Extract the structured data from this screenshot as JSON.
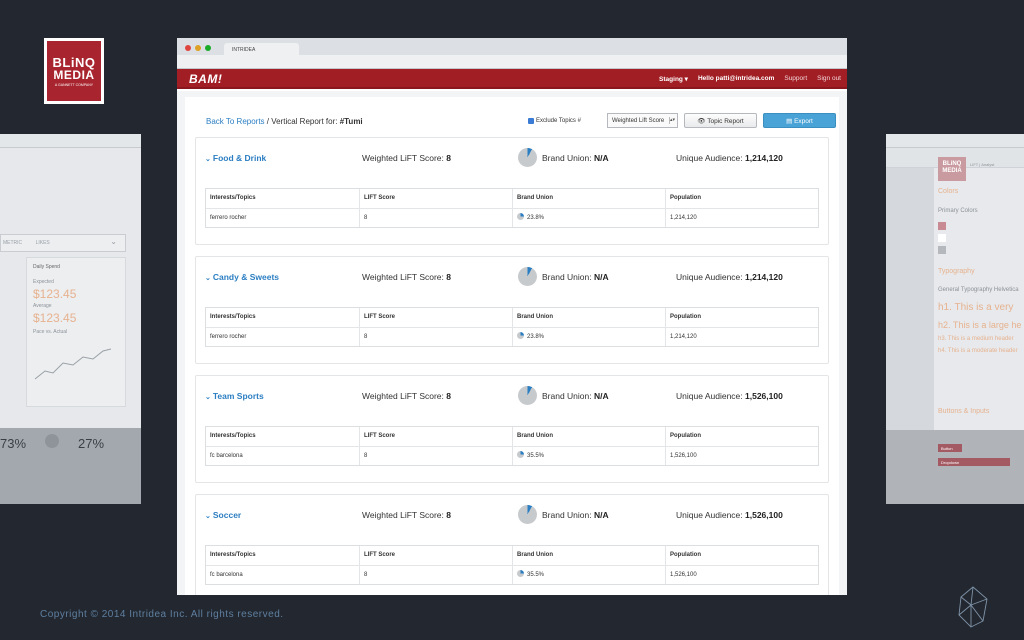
{
  "logo": {
    "line1": "BLiNQ",
    "line2": "MEDIA",
    "line3": "A GANNETT COMPANY"
  },
  "side_left": {
    "metric_label": "METRIC",
    "metric_value": "LIKES",
    "daily_spend_label": "Daily Spend",
    "expected_label": "Expected",
    "expected_value": "$123.45",
    "average_label": "Average",
    "average_value": "$123.45",
    "pace_label": "Pace vs. Actual",
    "pct_left": "73%",
    "pct_right": "27%"
  },
  "side_right": {
    "logo_l1": "BLiNQ",
    "logo_l2": "MEDIA",
    "header_text": "LIFT | Analyst",
    "colors_heading": "Colors",
    "primary_colors": "Primary Colors",
    "typography_heading": "Typography",
    "general_typography": "General Typography Helvetica",
    "h1": "h1. This is a very",
    "h2": "h2. This is a large he",
    "h3": "h3. This is a medium header",
    "h4": "h4. This is a moderate header",
    "buttons_heading": "Buttons & Inputs",
    "button_label": "Button",
    "dropdown_label": "Dropdown"
  },
  "browser": {
    "tab_title": "INTRIDEA",
    "dot_colors": [
      "#e0443e",
      "#dea123",
      "#1aab29"
    ]
  },
  "appbar": {
    "brand": "BAM!",
    "staging": "Staging ▾",
    "hello": "Hello patti@intridea.com",
    "support": "Support",
    "signout": "Sign out"
  },
  "toolbar": {
    "back_link": "Back To Reports",
    "crumb_rest": " / Vertical Report for: ",
    "crumb_tag": "#Tumi",
    "exclude_label": "Exclude Topics #",
    "select_value": "Weighted Lift Score",
    "topic_report": "👁 Topic Report",
    "export": "▤ Export"
  },
  "table_headers": [
    "Interests/Topics",
    "LIFT Score",
    "Brand Union",
    "Population"
  ],
  "sections": [
    {
      "title": "Food & Drink",
      "score_label": "Weighted LiFT Score: ",
      "score": "8",
      "union_label": "Brand Union: ",
      "union": "N/A",
      "aud_label": "Unique Audience: ",
      "aud": "1,214,120",
      "row": {
        "topic": "ferrero rocher",
        "lift": "8",
        "union": "23.8%",
        "pop": "1,214,120"
      }
    },
    {
      "title": "Candy & Sweets",
      "score_label": "Weighted LiFT Score: ",
      "score": "8",
      "union_label": "Brand Union: ",
      "union": "N/A",
      "aud_label": "Unique Audience: ",
      "aud": "1,214,120",
      "row": {
        "topic": "ferrero rocher",
        "lift": "8",
        "union": "23.8%",
        "pop": "1,214,120"
      }
    },
    {
      "title": "Team Sports",
      "score_label": "Weighted LiFT Score: ",
      "score": "8",
      "union_label": "Brand Union: ",
      "union": "N/A",
      "aud_label": "Unique Audience: ",
      "aud": "1,526,100",
      "row": {
        "topic": "fc barcelona",
        "lift": "8",
        "union": "35.5%",
        "pop": "1,526,100"
      }
    },
    {
      "title": "Soccer",
      "score_label": "Weighted LiFT Score: ",
      "score": "8",
      "union_label": "Brand Union: ",
      "union": "N/A",
      "aud_label": "Unique Audience: ",
      "aud": "1,526,100",
      "row": {
        "topic": "fc barcelona",
        "lift": "8",
        "union": "35.5%",
        "pop": "1,526,100"
      }
    }
  ],
  "footer": "Copyright © 2014 Intridea Inc. All rights reserved.",
  "colors": {
    "brand_red": "#a21e25",
    "link_blue": "#2b7ec2",
    "export_blue": "#4aa3d6",
    "background": "#232830"
  }
}
